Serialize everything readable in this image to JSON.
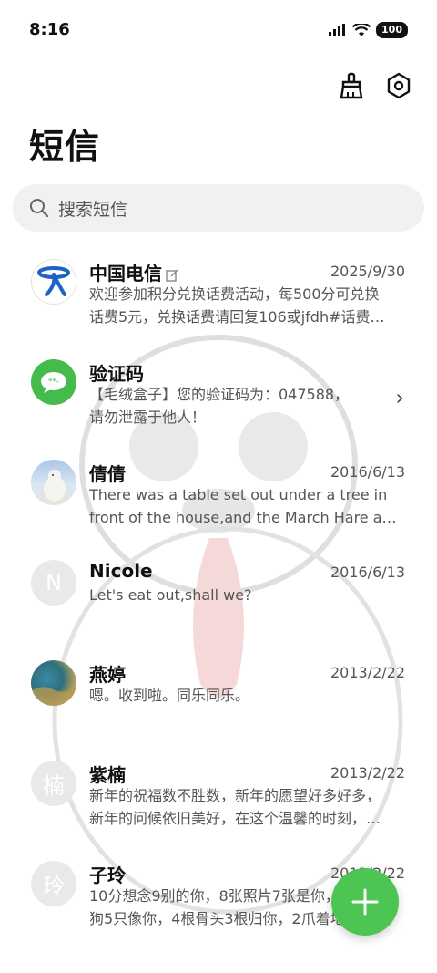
{
  "status": {
    "time": "8:16",
    "battery": "100"
  },
  "header": {
    "title": "短信"
  },
  "search": {
    "placeholder": "搜索短信"
  },
  "messages": [
    {
      "name": "中国电信",
      "date": "2025/9/30",
      "line1": "欢迎参加积分兑换话费活动，每500分可兑换",
      "line2": "话费5元，兑换话费请回复106或jfdh#话费…",
      "avatar": "telecom-logo"
    },
    {
      "name": "验证码",
      "date": "",
      "line1": "【毛绒盒子】您的验证码为：047588，",
      "line2": "请勿泄露于他人！",
      "avatar": "chat-bubble"
    },
    {
      "name": "倩倩",
      "date": "2016/6/13",
      "line1": "There was a table set out under a tree in",
      "line2": "front of the house,and the March Hare an…",
      "avatar": "polar-bear-photo"
    },
    {
      "name": "Nicole",
      "date": "2016/6/13",
      "line1": "Let's eat out,shall we?",
      "line2": "",
      "avatar_text": "N"
    },
    {
      "name": "燕婷",
      "date": "2013/2/22",
      "line1": "嗯。收到啦。同乐同乐。",
      "line2": "",
      "avatar": "landscape-photo"
    },
    {
      "name": "紫楠",
      "date": "2013/2/22",
      "line1": "新年的祝福数不胜数，新年的愿望好多好多，",
      "line2": "新年的问候依旧美好，在这个温馨的时刻，…",
      "avatar_text": "楠"
    },
    {
      "name": "子玲",
      "date": "2013/2/22",
      "line1": "10分想念9别的你，8张照片7张是你，6只小",
      "line2": "狗5只像你，4根骨头3根归你，2爪着地1定…",
      "avatar_text": "玲"
    }
  ],
  "colors": {
    "accent_green": "#4cc552",
    "search_bg": "#f1f1f1",
    "telecom_blue": "#1e62c4"
  }
}
